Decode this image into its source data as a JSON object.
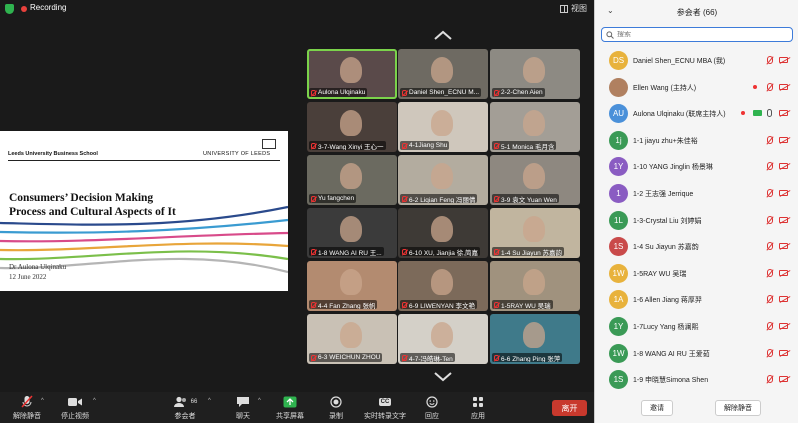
{
  "topbar": {
    "recording_label": "Recording",
    "view_label": "视图"
  },
  "slide": {
    "school": "Leeds University Business School",
    "university": "UNIVERSITY OF LEEDS",
    "title_line1": "Consumers’ Decision Making",
    "title_line2": "Process and Cultural Aspects of It",
    "author": "Dr Aulona Ulqinaku",
    "date": "12 June 2022",
    "stripe_colors": [
      "#2a4a8c",
      "#3a9bd1",
      "#d84b8a",
      "#e8a53a",
      "#7bbf4a",
      "#b5b5b5"
    ]
  },
  "gallery": {
    "tiles": [
      {
        "name": "Aulona Ulqinaku",
        "bg": "#5a4a4a",
        "active": true
      },
      {
        "name": "Daniel Shen_ECNU M...",
        "bg": "#6e6a62",
        "active": false
      },
      {
        "name": "2-2-Chen Aien",
        "bg": "#8d8a83",
        "active": false
      },
      {
        "name": "3-7-Wang Xinyi 王心一",
        "bg": "#4a3f3a",
        "active": false
      },
      {
        "name": "4-1Jiang Shu",
        "bg": "#cfc7bc",
        "active": false
      },
      {
        "name": "5-1 Monica 毛月含",
        "bg": "#a39e96",
        "active": false
      },
      {
        "name": "Yu fangchen",
        "bg": "#6b6a60",
        "active": false
      },
      {
        "name": "6-2 Liqian Feng 冯丽倩",
        "bg": "#b3ac9f",
        "active": false
      },
      {
        "name": "3-9 袁文 Yuan Wen",
        "bg": "#8e8880",
        "active": false
      },
      {
        "name": "1-8 WANG AI RU 王...",
        "bg": "#3b3b3b",
        "active": false
      },
      {
        "name": "6-10 XU, Jianjia 徐,简嘉",
        "bg": "#3e3a36",
        "active": false
      },
      {
        "name": "1-4 Su Jiayun 苏嘉韵",
        "bg": "#c1b59f",
        "active": false
      },
      {
        "name": "4-4 Fan Zhang 张帆",
        "bg": "#b38b70",
        "active": false
      },
      {
        "name": "6-9 LIWENYAN 李文艳",
        "bg": "#7c6a5a",
        "active": false
      },
      {
        "name": "1-5RAY WU 吴瑞",
        "bg": "#a0927e",
        "active": false
      },
      {
        "name": "6-3 WEICHUN ZHOU",
        "bg": "#c9c1b5",
        "active": false
      },
      {
        "name": "4-7-冯皓琳-Ten",
        "bg": "#d4d0c8",
        "active": false
      },
      {
        "name": "6-6 Zhang Ping 张萍",
        "bg": "#3f7a8a",
        "active": false
      }
    ]
  },
  "toolbar": {
    "unmute": "解除静音",
    "stop_video": "停止视频",
    "participants": "参会者",
    "participants_count": "66",
    "chat": "聊天",
    "share": "共享屏幕",
    "record": "录制",
    "captions": "实时转录文字",
    "reactions": "回应",
    "apps": "应用",
    "leave": "离开",
    "cc_badge": "CC"
  },
  "panel": {
    "title": "参会者 (66)",
    "search_placeholder": "搜索",
    "invite": "邀请",
    "unmute_me": "解除静音",
    "participants": [
      {
        "initials": "DS",
        "color": "#e8b23c",
        "name": "Daniel Shen_ECNU MBA (我)",
        "status": "off"
      },
      {
        "initials": "",
        "color": "#b08060",
        "name": "Ellen Wang (主持人)",
        "status": "host"
      },
      {
        "initials": "AU",
        "color": "#4a90d9",
        "name": "Aulona Ulqinaku (联席主持人)",
        "status": "cohost"
      },
      {
        "initials": "1j",
        "color": "#3a9a56",
        "name": "1-1 jiayu zhu+朱佳裕",
        "status": "off"
      },
      {
        "initials": "1Y",
        "color": "#8a5cc2",
        "name": "1-10 YANG Jinglin 杨景琳",
        "status": "off"
      },
      {
        "initials": "1",
        "color": "#8a5cc2",
        "name": "1-2 王志强 Jerrique",
        "status": "off"
      },
      {
        "initials": "1L",
        "color": "#3a9a56",
        "name": "1-3-Crystal Liu 刘婷娟",
        "status": "off"
      },
      {
        "initials": "1S",
        "color": "#c94a4a",
        "name": "1-4 Su Jiayun 苏嘉韵",
        "status": "off"
      },
      {
        "initials": "1W",
        "color": "#e8b23c",
        "name": "1-5RAY WU 吴瑞",
        "status": "off"
      },
      {
        "initials": "1A",
        "color": "#e8b23c",
        "name": "1-6 Allen Jiang 蒋厚羿",
        "status": "off"
      },
      {
        "initials": "1Y",
        "color": "#3a9a56",
        "name": "1-7Lucy Yang 杨澜熙",
        "status": "off"
      },
      {
        "initials": "1W",
        "color": "#3a9a56",
        "name": "1-8 WANG AI RU 王爱茹",
        "status": "off"
      },
      {
        "initials": "1S",
        "color": "#3a9a56",
        "name": "1-9 申晓慧Simona Shen",
        "status": "off"
      }
    ]
  }
}
